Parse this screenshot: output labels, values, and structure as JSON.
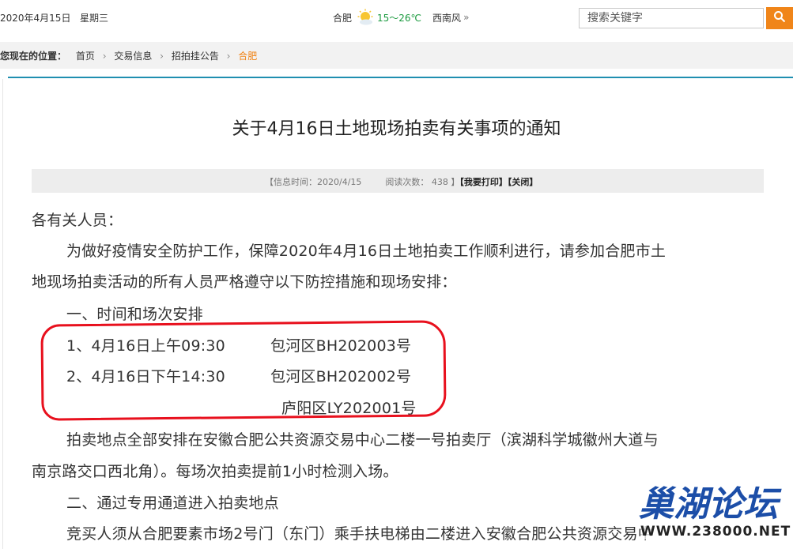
{
  "header": {
    "date": "2020年4月15日",
    "weekday": "星期三",
    "city": "合肥",
    "temp": "15～26℃",
    "wind": "西南风",
    "weather_icon": "sun-cloud-icon",
    "search_placeholder": "搜索关键字",
    "accent_color": "#f08519"
  },
  "breadcrumb": {
    "lead": "您现在的位置：",
    "items": [
      "首页",
      "交易信息",
      "招拍挂公告"
    ],
    "current": "合肥",
    "current_color": "#f08519"
  },
  "article": {
    "title": "关于4月16日土地现场拍卖有关事项的通知",
    "info_time_label": "【信息时间：",
    "info_time": "2020/4/15",
    "views_label": "阅读次数：",
    "views": "438",
    "views_close": "】",
    "print_label": "【我要打印】",
    "close_label": "【关闭】",
    "paragraphs": [
      "各有关人员：",
      "为做好疫情安全防护工作，保障2020年4月16日土地拍卖工作顺利进行，请参加合肥市土",
      "地现场拍卖活动的所有人员严格遵守以下防控措施和现场安排：",
      "一、时间和场次安排",
      "1、4月16日上午09:30",
      "包河区BH202003号",
      "2、4月16日下午14:30",
      "包河区BH202002号",
      "庐阳区LY202001号",
      "拍卖地点全部安排在安徽合肥公共资源交易中心二楼一号拍卖厅（滨湖科学城徽州大道与",
      "南京路交口西北角）。每场次拍卖提前1小时检测入场。",
      "二、通过专用通道进入拍卖地点",
      "竞买人须从合肥要素市场2号门（东门）乘手扶电梯由二楼进入安徽合肥公共资源交易中"
    ],
    "highlight_color": "#e8101d"
  },
  "watermark": {
    "name": "巢湖论坛",
    "url": "WWW.238000.NET"
  }
}
